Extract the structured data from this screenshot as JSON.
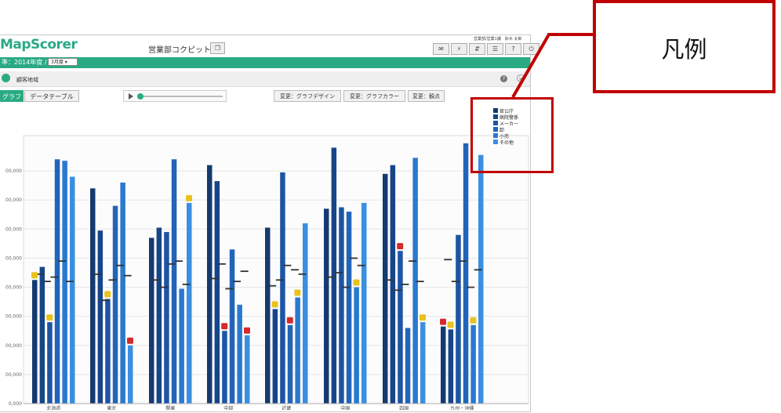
{
  "app": {
    "logo": "MapScorer",
    "cockpit_title": "営業部コクピット",
    "cockpit_button_icon": "copy-icon",
    "user_info": "営業部/営業1課　鈴木 太郎",
    "toolbar_icons": [
      "✉",
      "⚡",
      "⇵",
      "☰",
      "?",
      "⏻"
    ]
  },
  "period": {
    "label": "準：2014年度 /",
    "month": "3月度 ▾"
  },
  "section": {
    "title": "顧客地域"
  },
  "tabs": {
    "graph": "グラフ",
    "table": "データテーブル"
  },
  "buttons": {
    "design": "変更：グラフデザイン",
    "color": "変更：グラフカラー",
    "viewpoint": "変更：観点"
  },
  "chart_data": {
    "type": "bar",
    "ylim": [
      0,
      900000
    ],
    "yticks": [
      "0,000",
      "00,000",
      "00,000",
      "00,000",
      "00,000",
      "00,000",
      "00,000",
      "00,000",
      "00,000"
    ],
    "categories": [
      "北海道",
      "東北",
      "関東",
      "中部",
      "近畿",
      "中国",
      "四国",
      "九州・沖縄"
    ],
    "series": [
      {
        "name": "官公庁",
        "color": "#153a70",
        "values": [
          425000,
          740000,
          570000,
          820000,
          605000,
          670000,
          790000,
          265000
        ]
      },
      {
        "name": "病院警係",
        "color": "#17458a",
        "values": [
          470000,
          595000,
          605000,
          765000,
          325000,
          880000,
          820000,
          255000
        ]
      },
      {
        "name": "メーカー",
        "color": "#1d55a5",
        "values": [
          280000,
          360000,
          590000,
          250000,
          795000,
          675000,
          525000,
          580000
        ]
      },
      {
        "name": "卸",
        "color": "#2264b8",
        "values": [
          840000,
          680000,
          840000,
          530000,
          270000,
          660000,
          260000,
          895000
        ]
      },
      {
        "name": "小売",
        "color": "#2a79cf",
        "values": [
          835000,
          760000,
          395000,
          340000,
          365000,
          400000,
          845000,
          270000
        ]
      },
      {
        "name": "その他",
        "color": "#3a8fe0",
        "values": [
          780000,
          200000,
          690000,
          235000,
          620000,
          690000,
          280000,
          855000
        ]
      }
    ],
    "marker_values": [
      [
        445000,
        445000,
        425000,
        430000,
        405000,
        435000,
        425000,
        495000
      ],
      [
        420000,
        355000,
        400000,
        480000,
        425000,
        450000,
        390000,
        420000
      ],
      [
        435000,
        425000,
        480000,
        395000,
        475000,
        400000,
        410000,
        490000
      ],
      [
        490000,
        475000,
        490000,
        420000,
        460000,
        500000,
        490000,
        400000
      ],
      [
        420000,
        440000,
        410000,
        455000,
        445000,
        475000,
        420000,
        460000
      ]
    ],
    "badges": [
      {
        "cat": 0,
        "series": 0,
        "kind": "yellow"
      },
      {
        "cat": 0,
        "series": 2,
        "kind": "yellow"
      },
      {
        "cat": 1,
        "series": 2,
        "kind": "yellow"
      },
      {
        "cat": 1,
        "series": 5,
        "kind": "red"
      },
      {
        "cat": 2,
        "series": 5,
        "kind": "yellow"
      },
      {
        "cat": 3,
        "series": 2,
        "kind": "red"
      },
      {
        "cat": 3,
        "series": 5,
        "kind": "red"
      },
      {
        "cat": 4,
        "series": 1,
        "kind": "yellow"
      },
      {
        "cat": 4,
        "series": 3,
        "kind": "red"
      },
      {
        "cat": 4,
        "series": 4,
        "kind": "yellow"
      },
      {
        "cat": 5,
        "series": 4,
        "kind": "yellow"
      },
      {
        "cat": 6,
        "series": 2,
        "kind": "red"
      },
      {
        "cat": 6,
        "series": 5,
        "kind": "yellow"
      },
      {
        "cat": 7,
        "series": 0,
        "kind": "red"
      },
      {
        "cat": 7,
        "series": 1,
        "kind": "yellow"
      },
      {
        "cat": 7,
        "series": 4,
        "kind": "yellow"
      }
    ]
  },
  "annotation": {
    "callout_text": "凡例",
    "color": "#c00000"
  }
}
